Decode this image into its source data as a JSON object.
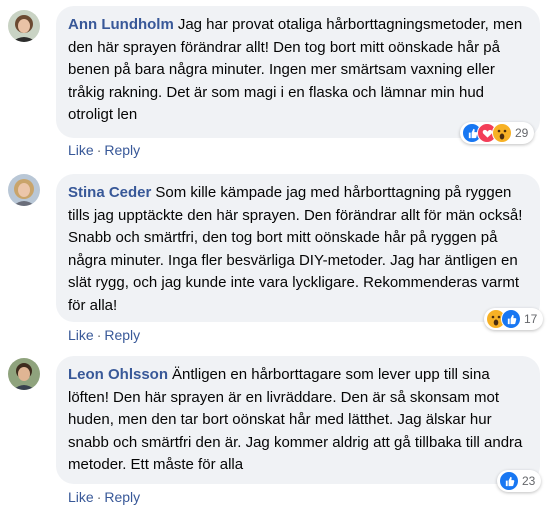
{
  "comments": [
    {
      "author": "Ann Lundholm",
      "text": "Jag har provat otaliga hårborttagningsmetoder, men den här sprayen förändrar allt! Den tog bort mitt oönskade hår på benen på bara några minuter. Ingen mer smärtsam vaxning eller tråkig rakning. Det är som magi i en flaska och lämnar min hud otroligt len",
      "like": "Like",
      "reply": "Reply",
      "reaction_count": "29",
      "reactions": [
        "like-icon",
        "love-icon",
        "wow-icon"
      ]
    },
    {
      "author": "Stina Ceder",
      "text": "Som kille kämpade jag med hårborttagning på ryggen tills jag upptäckte den här sprayen. Den förändrar allt för män också! Snabb och smärtfri, den tog bort mitt oönskade hår på ryggen på några minuter. Inga fler besvärliga DIY-metoder. Jag har äntligen en slät rygg, och jag kunde inte vara lyckligare. Rekommenderas varmt för alla!",
      "like": "Like",
      "reply": "Reply",
      "reaction_count": "17",
      "reactions": [
        "wow-icon",
        "like-icon"
      ]
    },
    {
      "author": "Leon Ohlsson",
      "text": "Äntligen en hårborttagare som lever upp till sina löften! Den här sprayen är en livräddare. Den är så skonsam mot huden, men den tar bort oönskat hår med lätthet. Jag älskar hur snabb och smärtfri den är. Jag kommer aldrig att gå tillbaka till andra metoder. Ett måste för alla",
      "like": "Like",
      "reply": "Reply",
      "reaction_count": "23",
      "reactions": [
        "like-icon"
      ]
    }
  ],
  "colors": {
    "author": "#385898",
    "bubble": "#f0f2f5",
    "like": "#1877f2",
    "love": "#f33e58",
    "wow": "#f7b125"
  }
}
